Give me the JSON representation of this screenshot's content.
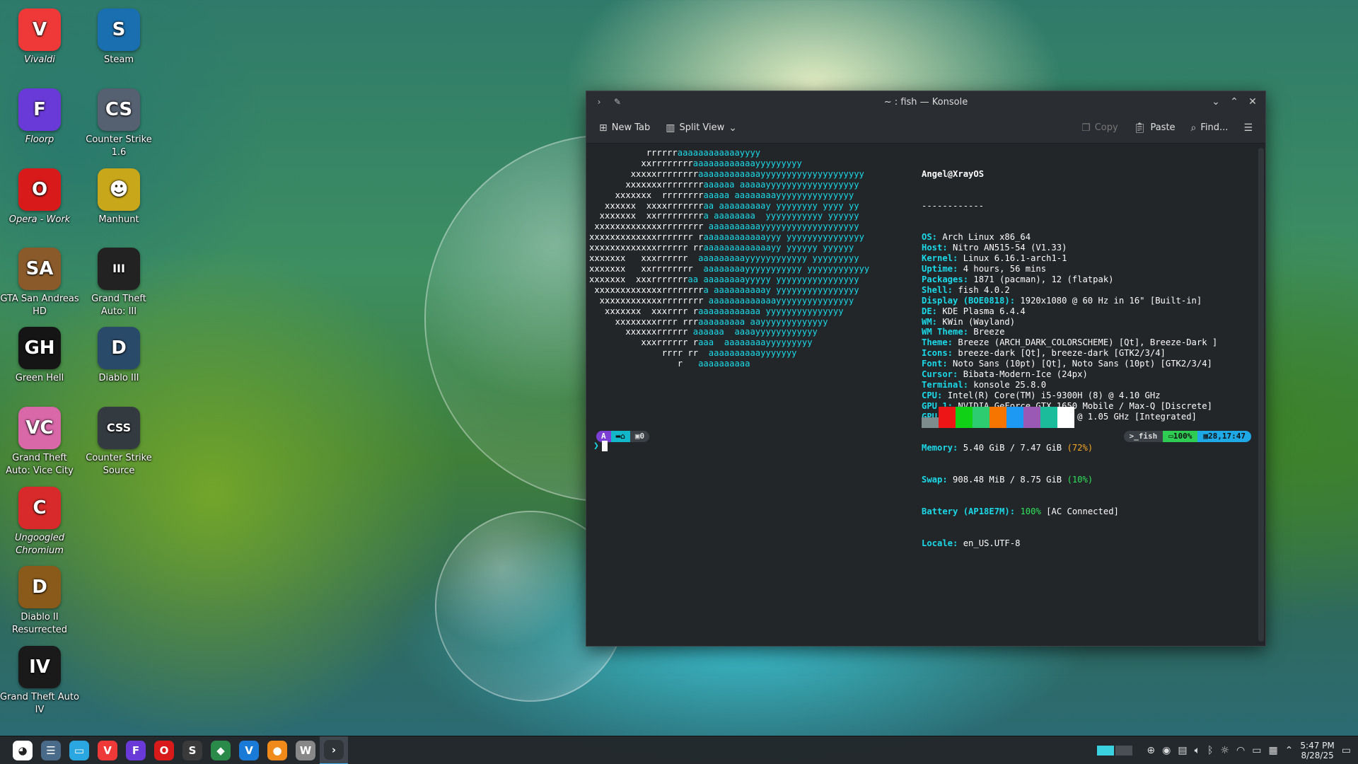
{
  "desktop": {
    "icons": [
      {
        "label": "Vivaldi",
        "italic": true,
        "glyph": "V",
        "color": "#ef3939"
      },
      {
        "label": "Steam",
        "italic": false,
        "glyph": "S",
        "color": "#1a6fb0"
      },
      {
        "label": "Floorp",
        "italic": true,
        "glyph": "F",
        "color": "#6a3ad8"
      },
      {
        "label": "Counter Strike 1.6",
        "italic": false,
        "glyph": "CS",
        "color": "#556070"
      },
      {
        "label": "Opera - Work",
        "italic": true,
        "glyph": "O",
        "color": "#d81a1a"
      },
      {
        "label": "Manhunt",
        "italic": false,
        "glyph": "☻",
        "color": "#c9a71a"
      },
      {
        "label": "GTA San Andreas HD",
        "italic": false,
        "glyph": "SA",
        "color": "#8a5a2a"
      },
      {
        "label": "Grand Theft Auto: III",
        "italic": false,
        "glyph": "III",
        "color": "#222222"
      },
      {
        "label": "Green Hell",
        "italic": false,
        "glyph": "GH",
        "color": "#151515"
      },
      {
        "label": "Diablo III",
        "italic": false,
        "glyph": "D",
        "color": "#2a4a6a"
      },
      {
        "label": "Grand Theft Auto: Vice City",
        "italic": false,
        "glyph": "VC",
        "color": "#d868a8"
      },
      {
        "label": "Counter Strike Source",
        "italic": false,
        "glyph": "CSS",
        "color": "#333a40"
      },
      {
        "label": "Ungoogled Chromium",
        "italic": true,
        "glyph": "C",
        "color": "#d82a2a"
      },
      {
        "label": "Diablo II Resurrected",
        "italic": false,
        "glyph": "D",
        "color": "#8a5a1a"
      },
      {
        "label": "Grand Theft Auto IV",
        "italic": false,
        "glyph": "IV",
        "color": "#1a1a1a"
      }
    ]
  },
  "window": {
    "title": "~ : fish — Konsole",
    "toolbar": {
      "new_tab": "New Tab",
      "split_view": "Split View",
      "copy": "Copy",
      "paste": "Paste",
      "find": "Find..."
    }
  },
  "terminal": {
    "user_host": "Angel@XrayOS",
    "separator": "------------",
    "info": [
      {
        "key": "OS",
        "value": "Arch Linux x86_64"
      },
      {
        "key": "Host",
        "value": "Nitro AN515-54 (V1.33)"
      },
      {
        "key": "Kernel",
        "value": "Linux 6.16.1-arch1-1"
      },
      {
        "key": "Uptime",
        "value": "4 hours, 56 mins"
      },
      {
        "key": "Packages",
        "value": "1871 (pacman), 12 (flatpak)"
      },
      {
        "key": "Shell",
        "value": "fish 4.0.2"
      },
      {
        "key": "Display (BOE0818)",
        "value": "1920x1080 @ 60 Hz in 16\" [Built-in]"
      },
      {
        "key": "DE",
        "value": "KDE Plasma 6.4.4"
      },
      {
        "key": "WM",
        "value": "KWin (Wayland)"
      },
      {
        "key": "WM Theme",
        "value": "Breeze"
      },
      {
        "key": "Theme",
        "value": "Breeze (ARCH_DARK_COLORSCHEME) [Qt], Breeze-Dark ]"
      },
      {
        "key": "Icons",
        "value": "breeze-dark [Qt], breeze-dark [GTK2/3/4]"
      },
      {
        "key": "Font",
        "value": "Noto Sans (10pt) [Qt], Noto Sans (10pt) [GTK2/3/4]"
      },
      {
        "key": "Cursor",
        "value": "Bibata-Modern-Ice (24px)"
      },
      {
        "key": "Terminal",
        "value": "konsole 25.8.0"
      },
      {
        "key": "CPU",
        "value": "Intel(R) Core(TM) i5-9300H (8) @ 4.10 GHz"
      },
      {
        "key": "GPU 1",
        "value": "NVIDIA GeForce GTX 1650 Mobile / Max-Q [Discrete]"
      },
      {
        "key": "GPU 2",
        "value": "Intel UHD Graphics 630 @ 1.05 GHz [Integrated]"
      }
    ],
    "memory": {
      "key": "Memory",
      "value": "5.40 GiB / 7.47 GiB",
      "pct": "(72%)"
    },
    "swap": {
      "key": "Swap",
      "value": "908.48 MiB / 8.75 GiB",
      "pct": "(10%)"
    },
    "battery": {
      "key": "Battery (AP18E7M)",
      "pct": "100%",
      "value": "[AC Connected]"
    },
    "locale": {
      "key": "Locale",
      "value": "en_US.UTF-8"
    },
    "logo": [
      "           rrrrrraaaaaaaaaaaayyyy",
      "          xxrrrrrrrraaaaaaaaaaaayyyyyyyyy",
      "        xxxxxrrrrrrrraaaaaaaaaaaayyyyyyyyyyyyyyyyyyyy",
      "       xxxxxxxrrrrrrrraaaaaa aaaaayyyyyyyyyyyyyyyyyy",
      "     xxxxxxx  rrrrrrrraaaaa aaaaaaaayyyyyyyyyyyyyyy",
      "   xxxxxx  xxxxrrrrrrraa aaaaaaaaay yyyyyyyy yyyy yy",
      "  xxxxxxx  xxrrrrrrrrra aaaaaaaa  yyyyyyyyyyy yyyyyy",
      " xxxxxxxxxxxxxrrrrrrrr aaaaaaaaaayyyyyyyyyyyyyyyyyyy",
      "xxxxxxxxxxxxxrrrrrrr raaaaaaaaaaaayyy yyyyyyyyyyyyyyy",
      "xxxxxxxxxxxxxrrrrrr rraaaaaaaaaaaaayy yyyyyy yyyyyy",
      "xxxxxxx   xxxrrrrrr  aaaaaaaaayyyyyyyyyyyy yyyyyyyyy",
      "xxxxxxx   xxrrrrrrrr  aaaaaaaayyyyyyyyyyy yyyyyyyyyyyy",
      "xxxxxxx  xxxrrrrrrraa aaaaaaaayyyyy yyyyyyyyyyyyyyyy",
      " xxxxxxxxxxxxxrrrrrrrra aaaaaaaaaay yyyyyyyyyyyyyyyy",
      "  xxxxxxxxxxxxrrrrrrrr aaaaaaaaaaaaayyyyyyyyyyyyyyy",
      "   xxxxxxx  xxxrrrr raaaaaaaaaaaa yyyyyyyyyyyyyyy",
      "     xxxxxxxxrrrr rrraaaaaaaaa aayyyyyyyyyyyyy",
      "       xxxxxxrrrrrr aaaaaa  aaaayyyyyyyyyyyy",
      "          xxxrrrrrr raaa  aaaaaaaayyyyyyyyy",
      "              rrrr rr  aaaaaaaaaayyyyyyy",
      "                 r   aaaaaaaaaa"
    ],
    "palette": [
      "#7f8c8d",
      "#ed1515",
      "#11d116",
      "#2ecc71",
      "#f67400",
      "#1d99f3",
      "#9b59b6",
      "#1abc9c",
      "#ffffff"
    ],
    "prompt": {
      "arch_icon": "A",
      "dir_icon": "home-icon",
      "jobs": "0",
      "shell": "fish",
      "battery": "100%",
      "time": "28,17:47"
    }
  },
  "taskbar": {
    "apps": [
      {
        "name": "launcher",
        "glyph": "◕",
        "color": "#ffffff"
      },
      {
        "name": "settings",
        "glyph": "☰",
        "color": "#4a6a8a"
      },
      {
        "name": "files",
        "glyph": "▭",
        "color": "#2aa7e0"
      },
      {
        "name": "vivaldi",
        "glyph": "V",
        "color": "#ef3939"
      },
      {
        "name": "floorp",
        "glyph": "F",
        "color": "#6a3ad8"
      },
      {
        "name": "opera",
        "glyph": "O",
        "color": "#d81a1a"
      },
      {
        "name": "sublime",
        "glyph": "S",
        "color": "#3a3a3a"
      },
      {
        "name": "picker",
        "glyph": "◆",
        "color": "#2a8a4a"
      },
      {
        "name": "vscode",
        "glyph": "V",
        "color": "#1a7ad8"
      },
      {
        "name": "browser",
        "glyph": "●",
        "color": "#f08a1a"
      },
      {
        "name": "app",
        "glyph": "W",
        "color": "#888888"
      },
      {
        "name": "konsole",
        "glyph": "›",
        "color": "#2f3438"
      }
    ],
    "clock": {
      "time": "5:47 PM",
      "date": "8/28/25"
    }
  }
}
